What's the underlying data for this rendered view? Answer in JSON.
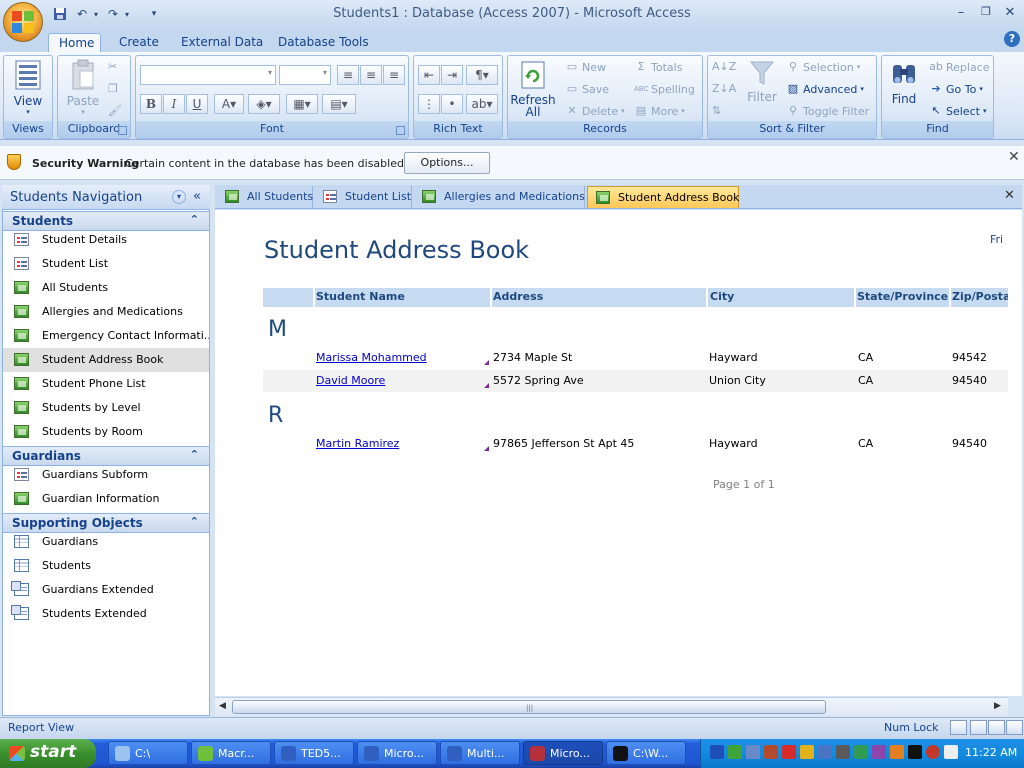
{
  "window": {
    "title": "Students1 : Database (Access 2007) - Microsoft Access",
    "minimize": "–",
    "restore": "❐",
    "close": "✕"
  },
  "ribbon_tabs": [
    "Home",
    "Create",
    "External Data",
    "Database Tools"
  ],
  "ribbon": {
    "views": {
      "label": "Views",
      "view_btn": "View"
    },
    "clipboard": {
      "label": "Clipboard",
      "paste_btn": "Paste"
    },
    "font": {
      "label": "Font"
    },
    "rich_text": {
      "label": "Rich Text"
    },
    "records": {
      "label": "Records",
      "refresh": "Refresh All",
      "new": "New",
      "save": "Save",
      "delete": "Delete",
      "totals": "Totals",
      "spelling": "Spelling",
      "more": "More"
    },
    "sort_filter": {
      "label": "Sort & Filter",
      "filter": "Filter",
      "selection": "Selection",
      "advanced": "Advanced",
      "toggle_filter": "Toggle Filter"
    },
    "find": {
      "label": "Find",
      "find": "Find",
      "replace": "Replace",
      "goto": "Go To",
      "select": "Select"
    }
  },
  "security_bar": {
    "title": "Security Warning",
    "message": "Certain content in the database has been disabled",
    "options_btn": "Options..."
  },
  "nav_pane": {
    "title": "Students Navigation",
    "sections": [
      {
        "name": "Students",
        "items": [
          {
            "label": "Student Details",
            "type": "form"
          },
          {
            "label": "Student List",
            "type": "form"
          },
          {
            "label": "All Students",
            "type": "report"
          },
          {
            "label": "Allergies and Medications",
            "type": "report"
          },
          {
            "label": "Emergency Contact Informati...",
            "type": "report"
          },
          {
            "label": "Student Address Book",
            "type": "report",
            "selected": true
          },
          {
            "label": "Student Phone List",
            "type": "report"
          },
          {
            "label": "Students by Level",
            "type": "report"
          },
          {
            "label": "Students by Room",
            "type": "report"
          }
        ]
      },
      {
        "name": "Guardians",
        "items": [
          {
            "label": "Guardians Subform",
            "type": "form"
          },
          {
            "label": "Guardian Information",
            "type": "report"
          }
        ]
      },
      {
        "name": "Supporting Objects",
        "items": [
          {
            "label": "Guardians",
            "type": "table"
          },
          {
            "label": "Students",
            "type": "table"
          },
          {
            "label": "Guardians Extended",
            "type": "query"
          },
          {
            "label": "Students Extended",
            "type": "query"
          }
        ]
      }
    ]
  },
  "doc_tabs": [
    {
      "label": "All Students",
      "type": "report"
    },
    {
      "label": "Student List",
      "type": "form"
    },
    {
      "label": "Allergies and Medications",
      "type": "report"
    },
    {
      "label": "Student Address Book",
      "type": "report",
      "active": true
    }
  ],
  "report": {
    "title": "Student Address Book",
    "date_fragment": "Fri",
    "columns": [
      "Student Name",
      "Address",
      "City",
      "State/Province",
      "Zip/Postal"
    ],
    "groups": [
      {
        "letter": "M",
        "rows": [
          {
            "name": "Marissa Mohammed",
            "address": "2734 Maple St",
            "city": "Hayward",
            "state": "CA",
            "zip": "94542"
          },
          {
            "name": "David Moore",
            "address": "5572 Spring Ave",
            "city": "Union City",
            "state": "CA",
            "zip": "94540"
          }
        ]
      },
      {
        "letter": "R",
        "rows": [
          {
            "name": "Martin Ramirez",
            "address": "97865 Jefferson St Apt 45",
            "city": "Hayward",
            "state": "CA",
            "zip": "94540"
          }
        ]
      }
    ],
    "pager": "Page 1 of 1"
  },
  "status_bar": {
    "left": "Report View",
    "right": "Num Lock"
  },
  "taskbar": {
    "start": "start",
    "tasks": [
      {
        "label": "C:\\",
        "color": "#9cc2ee"
      },
      {
        "label": "Macr...",
        "color": "#6fbf3a"
      },
      {
        "label": "TED5...",
        "color": "#2f5fbf"
      },
      {
        "label": "Micro...",
        "color": "#2f5fbf"
      },
      {
        "label": "Multi...",
        "color": "#2f5fbf"
      },
      {
        "label": "Micro...",
        "color": "#b5303a",
        "active": true
      },
      {
        "label": "C:\\W...",
        "color": "#111111"
      }
    ],
    "clock": "11:22 AM"
  }
}
